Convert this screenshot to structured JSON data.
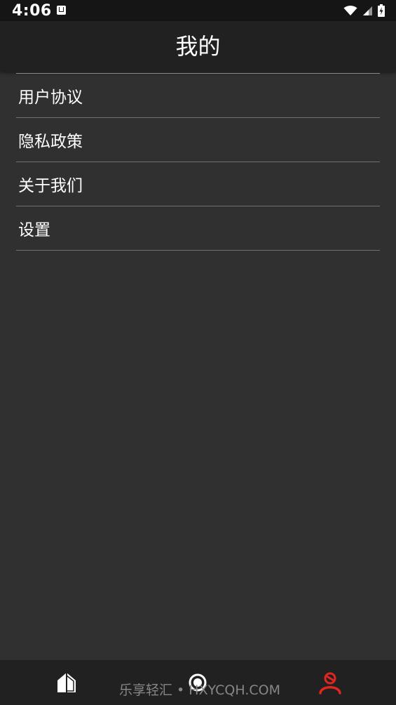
{
  "status_bar": {
    "time": "4:06",
    "notification_icon": "a-box-icon",
    "icons": [
      "wifi-icon",
      "cell-signal-icon",
      "battery-charging-icon"
    ]
  },
  "header": {
    "title": "我的"
  },
  "menu": {
    "items": [
      {
        "label": "用户协议"
      },
      {
        "label": "隐私政策"
      },
      {
        "label": "关于我们"
      },
      {
        "label": "设置"
      }
    ]
  },
  "bottom_nav": {
    "items": [
      {
        "icon": "home-icon",
        "active": false
      },
      {
        "icon": "discover-icon",
        "active": false
      },
      {
        "icon": "person-icon",
        "active": true
      }
    ]
  },
  "watermark": "乐享轻汇 • HXYCQH.COM",
  "colors": {
    "background": "#303030",
    "header": "#212121",
    "status_bar": "#151515",
    "active_accent": "#e0261f",
    "inactive_icon": "#ffffff"
  }
}
